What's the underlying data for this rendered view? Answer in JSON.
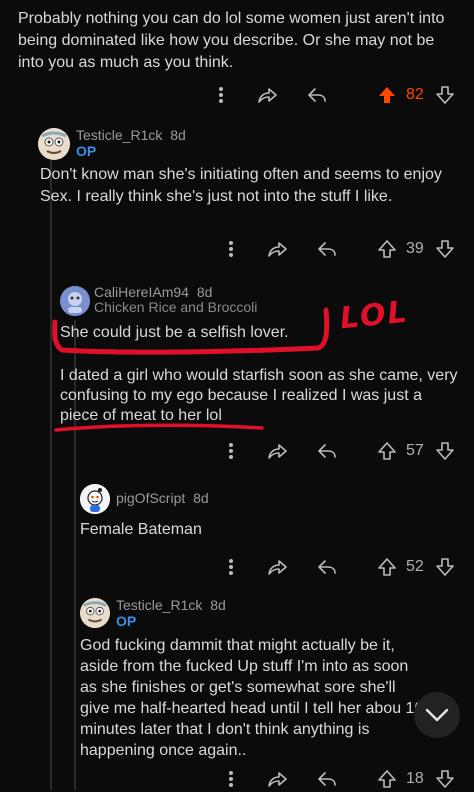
{
  "comments": [
    {
      "text": "Probably nothing you can do lol some women just aren't into being dominated like how you describe. Or she may not be into you as much as you think.",
      "votes": "82",
      "upvoted": true
    },
    {
      "user": "Testicle_R1ck",
      "age": "8d",
      "flair": "OP",
      "text": "Don't know man she's initiating often and seems to enjoy Sex. I really think she's just not into the stuff I like.",
      "votes": "39"
    },
    {
      "user": "CaliHereIAm94",
      "age": "8d",
      "subflair": "Chicken Rice and Broccoli",
      "text1": "She could just be a selfish lover.",
      "text2": "I dated a girl who would starfish soon as she came, very confusing to my ego because I realized I was just a piece of meat to her lol",
      "votes": "57"
    },
    {
      "user": "pigOfScript",
      "age": "8d",
      "text": "Female Bateman",
      "votes": "52"
    },
    {
      "user": "Testicle_R1ck",
      "age": "8d",
      "flair": "OP",
      "text": "God fucking dammit that might actually be it, aside from the fucked Up stuff I'm into as soon as she finishes or get's somewhat sore she'll give me half-hearted head until I tell her abou 10 minutes later that I don't think anything is happening once again..",
      "votes": "18"
    }
  ],
  "annotation": {
    "text": "LOL"
  },
  "colors": {
    "upvote_active": "#ff4500",
    "op_flair": "#3d8fe0",
    "marker": "#e0102a"
  },
  "icons": [
    "more-icon",
    "share-icon",
    "reply-icon",
    "upvote-icon",
    "downvote-icon",
    "chevron-down-icon"
  ]
}
